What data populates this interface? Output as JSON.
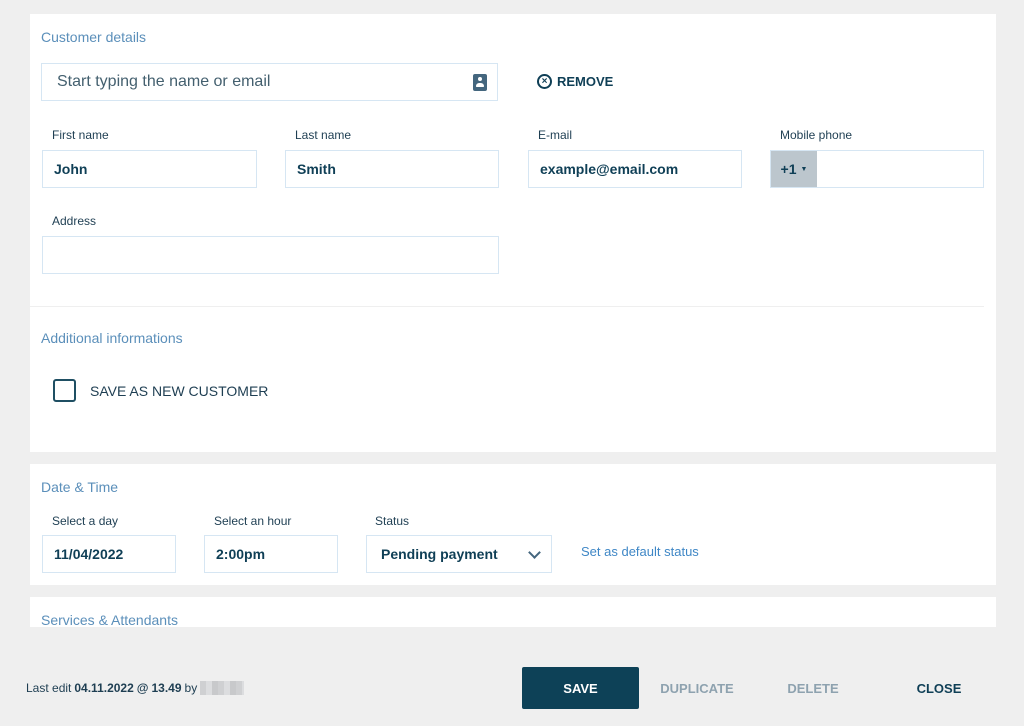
{
  "customer_details": {
    "title": "Customer details",
    "search_placeholder": "Start typing the name or email",
    "search_icon": "contact-book-icon",
    "remove_label": "REMOVE",
    "remove_icon": "x-circle-icon",
    "fields": {
      "first_name": {
        "label": "First name",
        "value": "John"
      },
      "last_name": {
        "label": "Last name",
        "value": "Smith"
      },
      "email": {
        "label": "E-mail",
        "value": "example@email.com"
      },
      "mobile_phone": {
        "label": "Mobile phone",
        "country_code": "+1",
        "value": ""
      },
      "address": {
        "label": "Address",
        "value": ""
      }
    }
  },
  "additional_info": {
    "title": "Additional informations",
    "save_as_new_customer": {
      "label": "SAVE AS NEW CUSTOMER",
      "checked": false
    }
  },
  "date_time": {
    "title": "Date & Time",
    "day": {
      "label": "Select a day",
      "value": "11/04/2022"
    },
    "hour": {
      "label": "Select an hour",
      "value": "2:00pm"
    },
    "status": {
      "label": "Status",
      "value": "Pending payment"
    },
    "set_default_link": "Set as default status"
  },
  "services": {
    "title": "Services & Attendants"
  },
  "footer": {
    "last_edit_prefix": "Last edit",
    "last_edit_date": "04.11.2022",
    "at": "@",
    "last_edit_time": "13.49",
    "by": "by",
    "buttons": {
      "save": "SAVE",
      "duplicate": "DUPLICATE",
      "delete": "DELETE",
      "close": "CLOSE"
    }
  },
  "colors": {
    "primary": "#0d4157",
    "section_title": "#5b8fba",
    "link": "#3f87c6",
    "muted_button": "#8ea2af",
    "background": "#efefef"
  }
}
